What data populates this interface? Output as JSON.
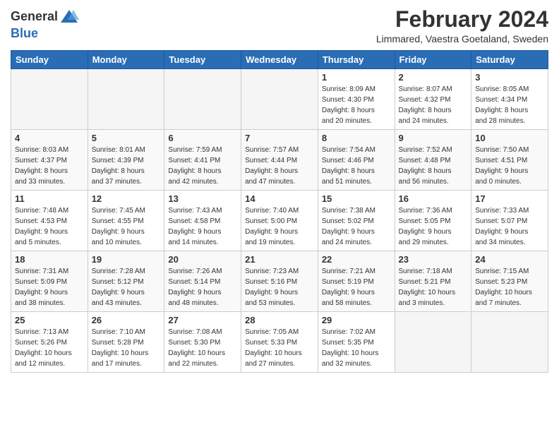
{
  "header": {
    "logo_line1": "General",
    "logo_line2": "Blue",
    "month_title": "February 2024",
    "location": "Limmared, Vaestra Goetaland, Sweden"
  },
  "weekdays": [
    "Sunday",
    "Monday",
    "Tuesday",
    "Wednesday",
    "Thursday",
    "Friday",
    "Saturday"
  ],
  "weeks": [
    [
      {
        "day": "",
        "info": ""
      },
      {
        "day": "",
        "info": ""
      },
      {
        "day": "",
        "info": ""
      },
      {
        "day": "",
        "info": ""
      },
      {
        "day": "1",
        "info": "Sunrise: 8:09 AM\nSunset: 4:30 PM\nDaylight: 8 hours\nand 20 minutes."
      },
      {
        "day": "2",
        "info": "Sunrise: 8:07 AM\nSunset: 4:32 PM\nDaylight: 8 hours\nand 24 minutes."
      },
      {
        "day": "3",
        "info": "Sunrise: 8:05 AM\nSunset: 4:34 PM\nDaylight: 8 hours\nand 28 minutes."
      }
    ],
    [
      {
        "day": "4",
        "info": "Sunrise: 8:03 AM\nSunset: 4:37 PM\nDaylight: 8 hours\nand 33 minutes."
      },
      {
        "day": "5",
        "info": "Sunrise: 8:01 AM\nSunset: 4:39 PM\nDaylight: 8 hours\nand 37 minutes."
      },
      {
        "day": "6",
        "info": "Sunrise: 7:59 AM\nSunset: 4:41 PM\nDaylight: 8 hours\nand 42 minutes."
      },
      {
        "day": "7",
        "info": "Sunrise: 7:57 AM\nSunset: 4:44 PM\nDaylight: 8 hours\nand 47 minutes."
      },
      {
        "day": "8",
        "info": "Sunrise: 7:54 AM\nSunset: 4:46 PM\nDaylight: 8 hours\nand 51 minutes."
      },
      {
        "day": "9",
        "info": "Sunrise: 7:52 AM\nSunset: 4:48 PM\nDaylight: 8 hours\nand 56 minutes."
      },
      {
        "day": "10",
        "info": "Sunrise: 7:50 AM\nSunset: 4:51 PM\nDaylight: 9 hours\nand 0 minutes."
      }
    ],
    [
      {
        "day": "11",
        "info": "Sunrise: 7:48 AM\nSunset: 4:53 PM\nDaylight: 9 hours\nand 5 minutes."
      },
      {
        "day": "12",
        "info": "Sunrise: 7:45 AM\nSunset: 4:55 PM\nDaylight: 9 hours\nand 10 minutes."
      },
      {
        "day": "13",
        "info": "Sunrise: 7:43 AM\nSunset: 4:58 PM\nDaylight: 9 hours\nand 14 minutes."
      },
      {
        "day": "14",
        "info": "Sunrise: 7:40 AM\nSunset: 5:00 PM\nDaylight: 9 hours\nand 19 minutes."
      },
      {
        "day": "15",
        "info": "Sunrise: 7:38 AM\nSunset: 5:02 PM\nDaylight: 9 hours\nand 24 minutes."
      },
      {
        "day": "16",
        "info": "Sunrise: 7:36 AM\nSunset: 5:05 PM\nDaylight: 9 hours\nand 29 minutes."
      },
      {
        "day": "17",
        "info": "Sunrise: 7:33 AM\nSunset: 5:07 PM\nDaylight: 9 hours\nand 34 minutes."
      }
    ],
    [
      {
        "day": "18",
        "info": "Sunrise: 7:31 AM\nSunset: 5:09 PM\nDaylight: 9 hours\nand 38 minutes."
      },
      {
        "day": "19",
        "info": "Sunrise: 7:28 AM\nSunset: 5:12 PM\nDaylight: 9 hours\nand 43 minutes."
      },
      {
        "day": "20",
        "info": "Sunrise: 7:26 AM\nSunset: 5:14 PM\nDaylight: 9 hours\nand 48 minutes."
      },
      {
        "day": "21",
        "info": "Sunrise: 7:23 AM\nSunset: 5:16 PM\nDaylight: 9 hours\nand 53 minutes."
      },
      {
        "day": "22",
        "info": "Sunrise: 7:21 AM\nSunset: 5:19 PM\nDaylight: 9 hours\nand 58 minutes."
      },
      {
        "day": "23",
        "info": "Sunrise: 7:18 AM\nSunset: 5:21 PM\nDaylight: 10 hours\nand 3 minutes."
      },
      {
        "day": "24",
        "info": "Sunrise: 7:15 AM\nSunset: 5:23 PM\nDaylight: 10 hours\nand 7 minutes."
      }
    ],
    [
      {
        "day": "25",
        "info": "Sunrise: 7:13 AM\nSunset: 5:26 PM\nDaylight: 10 hours\nand 12 minutes."
      },
      {
        "day": "26",
        "info": "Sunrise: 7:10 AM\nSunset: 5:28 PM\nDaylight: 10 hours\nand 17 minutes."
      },
      {
        "day": "27",
        "info": "Sunrise: 7:08 AM\nSunset: 5:30 PM\nDaylight: 10 hours\nand 22 minutes."
      },
      {
        "day": "28",
        "info": "Sunrise: 7:05 AM\nSunset: 5:33 PM\nDaylight: 10 hours\nand 27 minutes."
      },
      {
        "day": "29",
        "info": "Sunrise: 7:02 AM\nSunset: 5:35 PM\nDaylight: 10 hours\nand 32 minutes."
      },
      {
        "day": "",
        "info": ""
      },
      {
        "day": "",
        "info": ""
      }
    ]
  ]
}
